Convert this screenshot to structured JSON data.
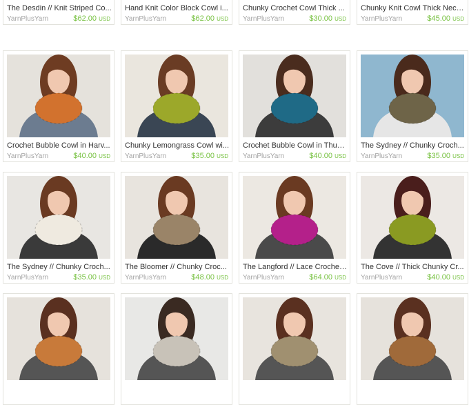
{
  "listings": [
    {
      "title": "The Desdin // Knit Striped Co...",
      "shop": "YarnPlusYarn",
      "price": "$62.00",
      "currency": "USD",
      "scarf_color": "#c86a2a",
      "bg_color": "#dfe2e4",
      "hair_color": "#7a4a2e",
      "shirt_color": "#4a4a52"
    },
    {
      "title": "Hand Knit Color Block Cowl i...",
      "shop": "YarnPlusYarn",
      "price": "$62.00",
      "currency": "USD",
      "scarf_color": "#c9a43a",
      "bg_color": "#e4e6e8",
      "hair_color": "#6b4028",
      "shirt_color": "#3f4656"
    },
    {
      "title": "Chunky Crochet Cowl Thick ...",
      "shop": "YarnPlusYarn",
      "price": "$30.00",
      "currency": "USD",
      "scarf_color": "#6e8a2c",
      "bg_color": "#e2e2e0",
      "hair_color": "#3a2a20",
      "shirt_color": "#2c2c2c"
    },
    {
      "title": "Chunky Knit Cowl Thick Neck...",
      "shop": "YarnPlusYarn",
      "price": "$45.00",
      "currency": "USD",
      "scarf_color": "#8ab032",
      "bg_color": "#e6e6e4",
      "hair_color": "#3a2a20",
      "shirt_color": "#2c2c2c"
    },
    {
      "title": "Crochet Bubble Cowl in Harv...",
      "shop": "YarnPlusYarn",
      "price": "$40.00",
      "currency": "USD",
      "scarf_color": "#d2722e",
      "bg_color": "#e5e2dc",
      "hair_color": "#6e3c22",
      "shirt_color": "#6c7c90"
    },
    {
      "title": "Chunky Lemongrass Cowl wi...",
      "shop": "YarnPlusYarn",
      "price": "$35.00",
      "currency": "USD",
      "scarf_color": "#9ca82a",
      "bg_color": "#eae6de",
      "hair_color": "#6a3c24",
      "shirt_color": "#3a4654"
    },
    {
      "title": "Crochet Bubble Cowl in Thun...",
      "shop": "YarnPlusYarn",
      "price": "$40.00",
      "currency": "USD",
      "scarf_color": "#1f6a86",
      "bg_color": "#e2e0dc",
      "hair_color": "#4a2c1e",
      "shirt_color": "#3c3c3c"
    },
    {
      "title": "The Sydney // Chunky Croch...",
      "shop": "YarnPlusYarn",
      "price": "$35.00",
      "currency": "USD",
      "scarf_color": "#6e6448",
      "bg_color": "#8fb7cf",
      "hair_color": "#4a2a1c",
      "shirt_color": "#e6e6e6"
    },
    {
      "title": "The Sydney // Chunky Croch...",
      "shop": "YarnPlusYarn",
      "price": "$35.00",
      "currency": "USD",
      "scarf_color": "#efeae0",
      "bg_color": "#e8e6e2",
      "hair_color": "#6a3a22",
      "shirt_color": "#3a3a3a"
    },
    {
      "title": "The Bloomer // Chunky Croc...",
      "shop": "YarnPlusYarn",
      "price": "$48.00",
      "currency": "USD",
      "scarf_color": "#9a8468",
      "bg_color": "#e8e4de",
      "hair_color": "#6a3a22",
      "shirt_color": "#2a2a2a"
    },
    {
      "title": "The Langford // Lace Crochet...",
      "shop": "YarnPlusYarn",
      "price": "$64.00",
      "currency": "USD",
      "scarf_color": "#b4208a",
      "bg_color": "#ece8e2",
      "hair_color": "#6a3a22",
      "shirt_color": "#4a4a4a"
    },
    {
      "title": "The Cove // Thick Chunky Cr...",
      "shop": "YarnPlusYarn",
      "price": "$40.00",
      "currency": "USD",
      "scarf_color": "#8a9a22",
      "bg_color": "#ece8e4",
      "hair_color": "#4a1e1c",
      "shirt_color": "#333333"
    },
    {
      "title": "",
      "shop": "",
      "price": "",
      "currency": "",
      "scarf_color": "#c87a3a",
      "bg_color": "#e6e2dc",
      "hair_color": "#5a3020",
      "shirt_color": "#555555"
    },
    {
      "title": "",
      "shop": "",
      "price": "",
      "currency": "",
      "scarf_color": "#c8c2b8",
      "bg_color": "#e8e8e6",
      "hair_color": "#3a2a22",
      "shirt_color": "#555555"
    },
    {
      "title": "",
      "shop": "",
      "price": "",
      "currency": "",
      "scarf_color": "#a09070",
      "bg_color": "#e8e4de",
      "hair_color": "#5a3020",
      "shirt_color": "#555555"
    },
    {
      "title": "",
      "shop": "",
      "price": "",
      "currency": "",
      "scarf_color": "#a06a3a",
      "bg_color": "#e6e2dc",
      "hair_color": "#5a3020",
      "shirt_color": "#555555"
    }
  ]
}
